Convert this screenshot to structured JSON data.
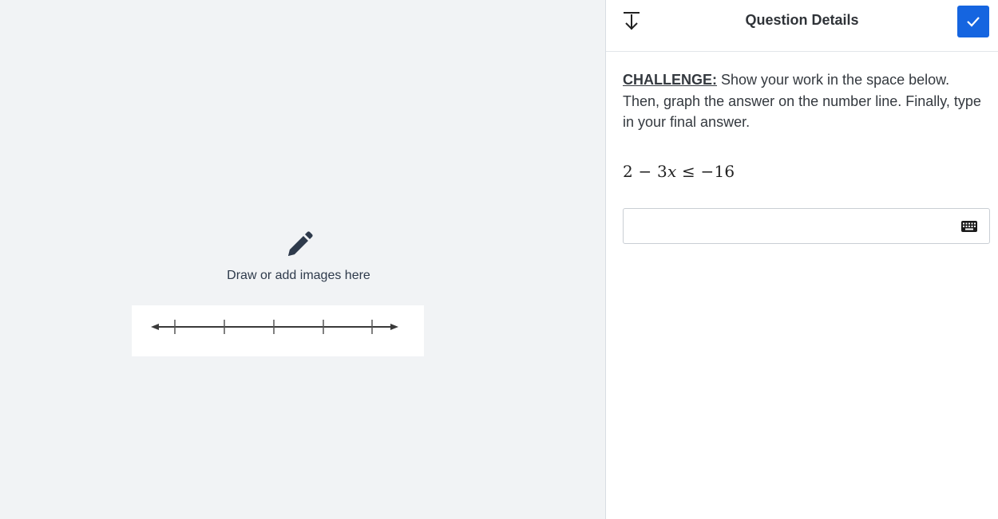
{
  "canvas": {
    "draw_label": "Draw or add images here",
    "pencil_icon": "pencil-icon",
    "number_line_icon": "number-line-image"
  },
  "panel": {
    "title": "Question Details",
    "collapse_icon": "collapse-down-icon",
    "confirm_icon": "checkmark-icon",
    "confirm_color": "#1565e0"
  },
  "question": {
    "challenge_label": "CHALLENGE:",
    "instructions": " Show your work in the space below. Then, graph the answer on the number line. Finally, type in your final answer.",
    "equation": {
      "lhs_const": "2",
      "minus": " − ",
      "coef": "3",
      "var": "x",
      "relation": " ≤ ",
      "rhs": "−16"
    }
  },
  "answer": {
    "value": "",
    "placeholder": "",
    "keyboard_icon": "keyboard-icon"
  }
}
